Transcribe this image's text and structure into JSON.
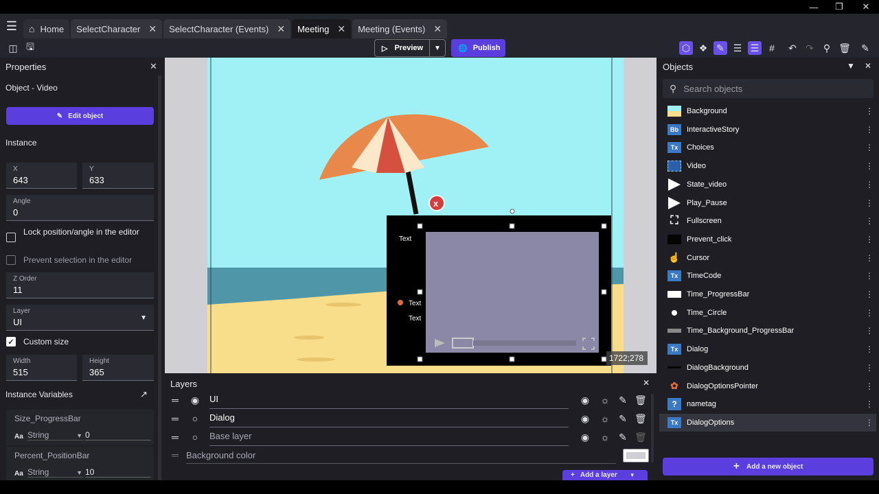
{
  "tabs": [
    {
      "label": "Home",
      "icon": "home-icon"
    },
    {
      "label": "SelectCharacter",
      "closable": true
    },
    {
      "label": "SelectCharacter (Events)",
      "closable": true
    },
    {
      "label": "Meeting",
      "closable": true,
      "active": true
    },
    {
      "label": "Meeting (Events)",
      "closable": true
    }
  ],
  "toolbar": {
    "preview_label": "Preview",
    "publish_label": "Publish"
  },
  "properties": {
    "title": "Properties",
    "object_label": "Object  - Video",
    "edit_object_label": "Edit object",
    "instance_label": "Instance",
    "x_label": "X",
    "x_value": "643",
    "y_label": "Y",
    "y_value": "633",
    "angle_label": "Angle",
    "angle_value": "0",
    "lock_label": "Lock position/angle in the editor",
    "prevent_label": "Prevent selection in the editor",
    "zorder_label": "Z Order",
    "zorder_value": "11",
    "layer_label": "Layer",
    "layer_value": "UI",
    "custom_size_label": "Custom size",
    "width_label": "Width",
    "width_value": "515",
    "height_label": "Height",
    "height_value": "365",
    "instance_vars_label": "Instance Variables",
    "variables": [
      {
        "name": "Size_ProgressBar",
        "type": "String",
        "value": "0"
      },
      {
        "name": "Percent_PositionBar",
        "type": "String",
        "value": "10"
      }
    ]
  },
  "scene": {
    "texts": [
      "Text",
      "Text",
      "Text"
    ],
    "coords": "1722;278",
    "colors": {
      "sky": "#a0f1f5",
      "sea": "#4f97a8",
      "sand": "#f8de8a",
      "umbrella_orange": "#e8884a",
      "umbrella_red": "#d6503f",
      "umbrella_cream": "#fbe8c8"
    }
  },
  "layers": {
    "title": "Layers",
    "items": [
      {
        "name": "UI",
        "selected": true
      },
      {
        "name": "Dialog",
        "selected": false
      },
      {
        "name": "Base layer",
        "selected": false
      }
    ],
    "background_color_label": "Background color",
    "add_layer_label": "Add a layer"
  },
  "objects": {
    "title": "Objects",
    "search_placeholder": "Search objects",
    "items": [
      {
        "name": "Background",
        "icon": "image-icon"
      },
      {
        "name": "InteractiveStory",
        "icon": "bbtext-icon"
      },
      {
        "name": "Choices",
        "icon": "text-icon"
      },
      {
        "name": "Video",
        "icon": "video-icon"
      },
      {
        "name": "State_video",
        "icon": "play-icon"
      },
      {
        "name": "Play_Pause",
        "icon": "play-icon"
      },
      {
        "name": "Fullscreen",
        "icon": "fullscreen-icon"
      },
      {
        "name": "Prevent_click",
        "icon": "black-rect-icon"
      },
      {
        "name": "Cursor",
        "icon": "hand-cursor-icon"
      },
      {
        "name": "TimeCode",
        "icon": "text-icon"
      },
      {
        "name": "Time_ProgressBar",
        "icon": "white-rect-icon"
      },
      {
        "name": "Time_Circle",
        "icon": "circle-icon"
      },
      {
        "name": "Time_Background_ProgressBar",
        "icon": "gray-rect-icon"
      },
      {
        "name": "Dialog",
        "icon": "text-icon"
      },
      {
        "name": "DialogBackground",
        "icon": "black-line-icon"
      },
      {
        "name": "DialogOptionsPointer",
        "icon": "paw-icon"
      },
      {
        "name": "nametag",
        "icon": "question-icon"
      },
      {
        "name": "DialogOptions",
        "icon": "text-icon",
        "selected": true
      }
    ],
    "add_object_label": "Add a new object"
  },
  "colors": {
    "accent": "#5b3fde",
    "panel": "#1e1e24",
    "titlebar": "#25252d"
  }
}
